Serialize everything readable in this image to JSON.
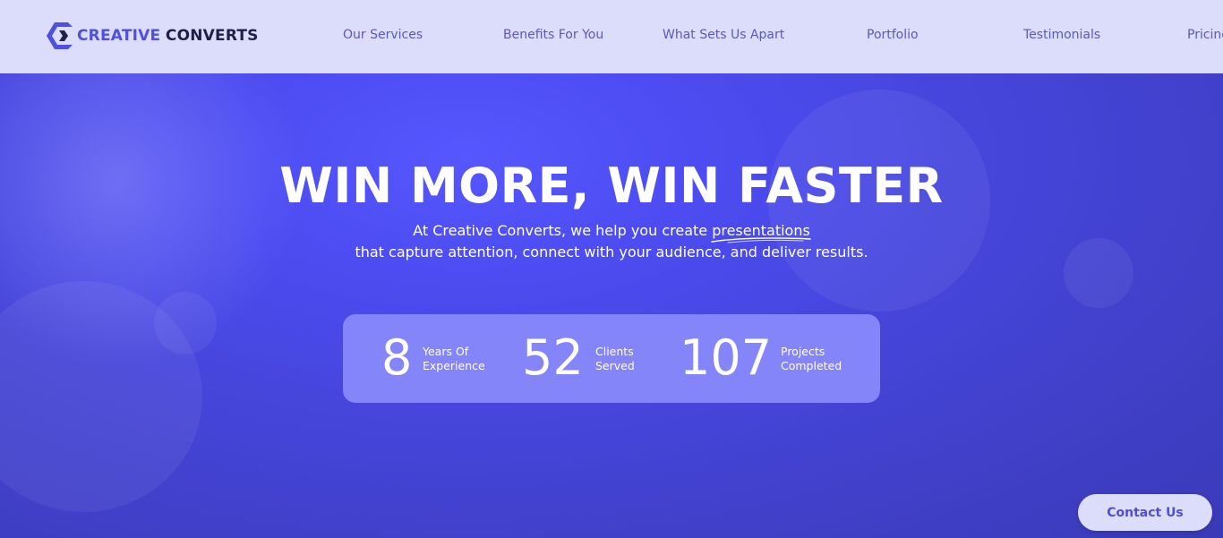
{
  "brand": {
    "part1": "CREATIVE",
    "part2": "CONVERTS",
    "accent": "#4f4fe0",
    "dark": "#1f1f4a"
  },
  "nav": {
    "items": [
      {
        "label": "Our Services"
      },
      {
        "label": "Benefits For You"
      },
      {
        "label": "What Sets Us Apart"
      },
      {
        "label": "Portfolio"
      },
      {
        "label": "Testimonials"
      },
      {
        "label": "Pricing"
      }
    ]
  },
  "hero": {
    "title": "WIN MORE, WIN FASTER",
    "subtitle_line1_prefix": "At Creative Converts, we help you create ",
    "subtitle_line1_highlight": "presentations",
    "subtitle_line2": "that capture attention, connect with your audience, and deliver results."
  },
  "stats": [
    {
      "number": "8",
      "label_line1": "Years Of",
      "label_line2": "Experience"
    },
    {
      "number": "52",
      "label_line1": "Clients",
      "label_line2": "Served"
    },
    {
      "number": "107",
      "label_line1": "Projects",
      "label_line2": "Completed"
    }
  ],
  "contact": {
    "label": "Contact Us"
  },
  "colors": {
    "nav_bg": "#dcdcfb",
    "hero_primary": "#4c4cf2",
    "stats_bg": "#8585fa"
  }
}
